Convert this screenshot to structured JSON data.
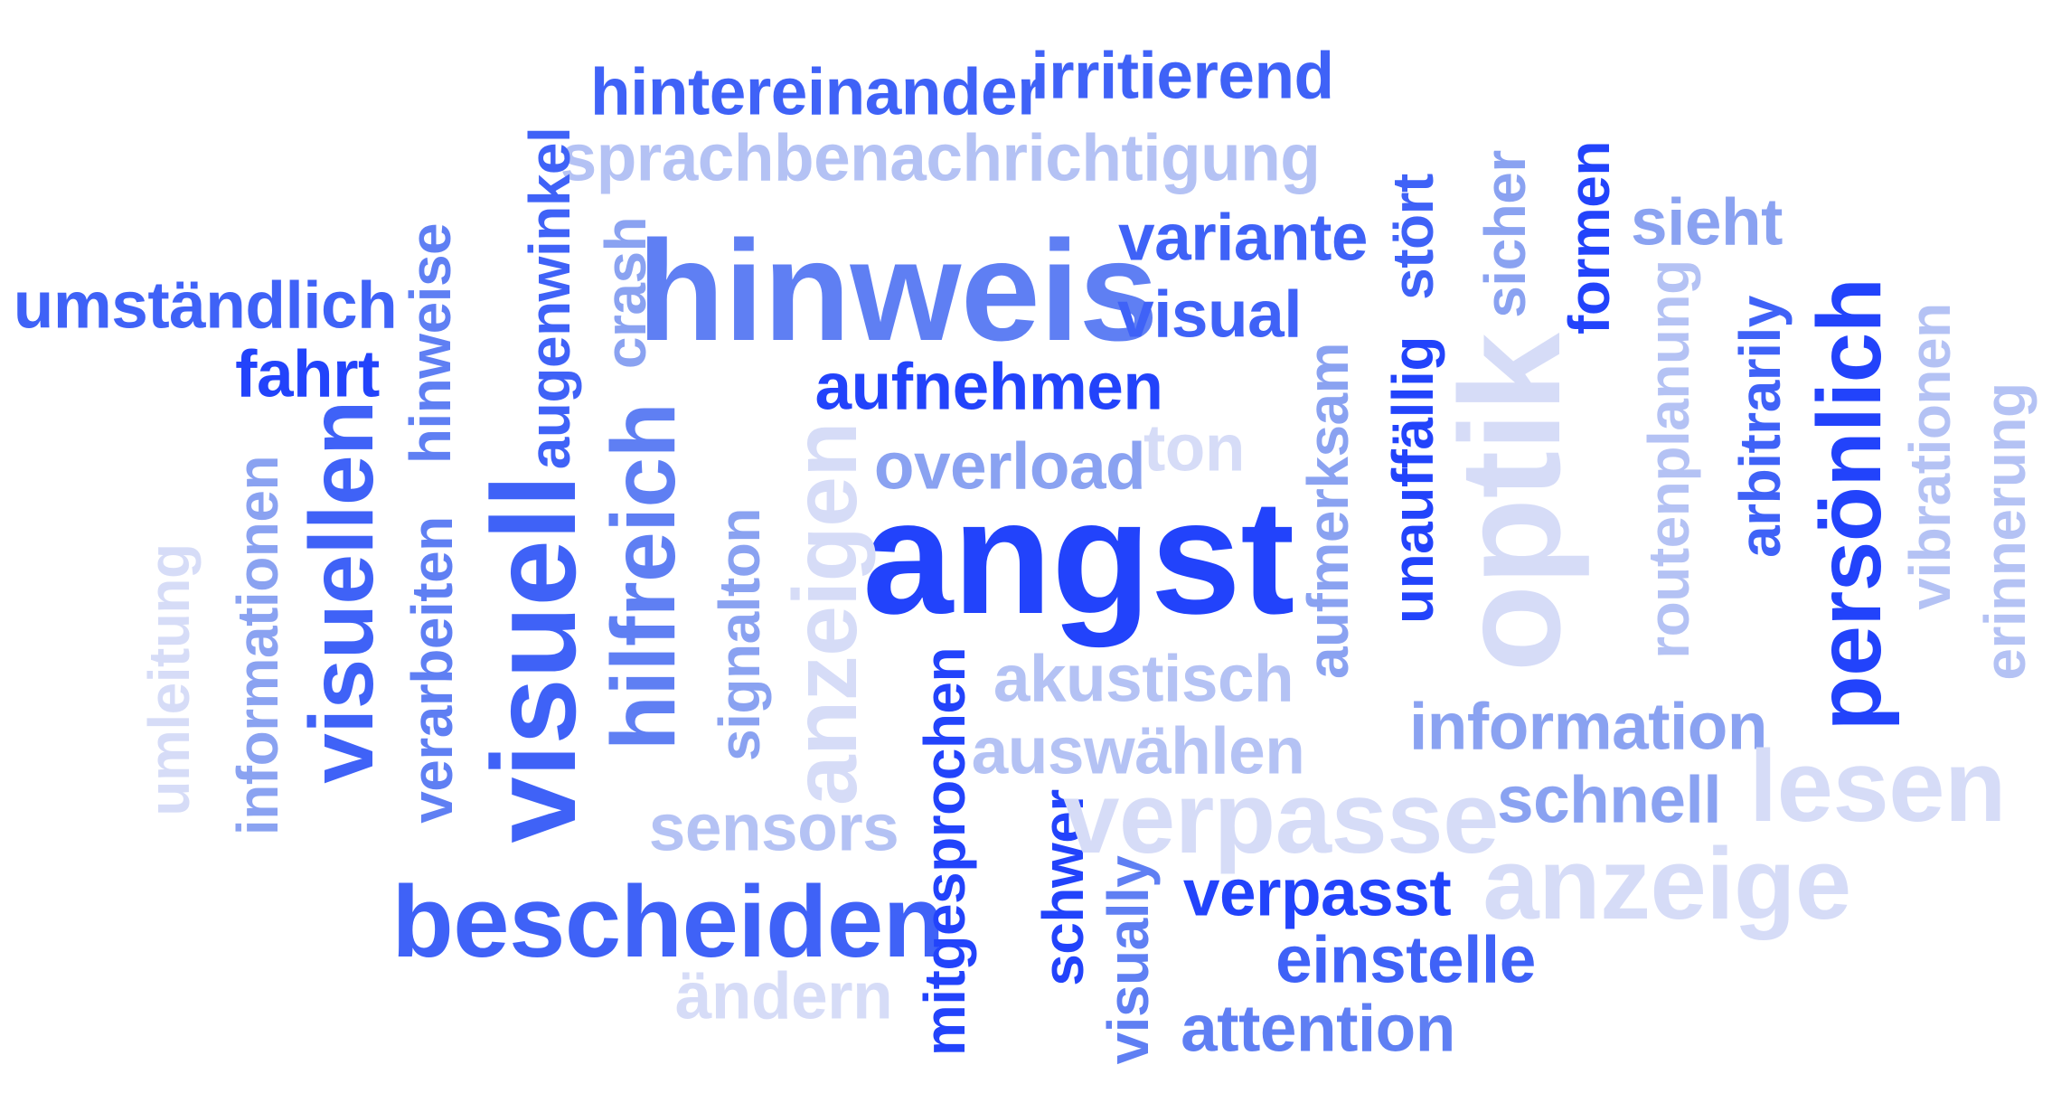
{
  "words": {
    "hintereinander": "hintereinander",
    "irritierend": "irritierend",
    "sprachbenachrichtigung": "sprachbenachrichtigung",
    "hinweis": "hinweis",
    "variante": "variante",
    "visual": "visual",
    "aufnehmen": "aufnehmen",
    "ton": "ton",
    "overload": "overload",
    "angst": "angst",
    "umstaendlich": "umständlich",
    "fahrt": "fahrt",
    "augenwinkel": "augenwinkel",
    "hinweise": "hinweise",
    "crash": "crash",
    "visuellen": "visuellen",
    "visuell": "visuell",
    "hilfreich": "hilfreich",
    "informationen": "informationen",
    "umleitung": "umleitung",
    "verarbeiten": "verarbeiten",
    "signalton": "signalton",
    "anzeigen": "anzeigen",
    "akustisch": "akustisch",
    "auswaehlen": "auswählen",
    "sensors": "sensors",
    "bescheiden": "bescheiden",
    "aendern": "ändern",
    "mitgesprochen": "mitgesprochen",
    "schwer": "schwer",
    "visually": "visually",
    "verpasse": "verpasse",
    "verpasst": "verpasst",
    "einstelle": "einstelle",
    "attention": "attention",
    "aufmerksam": "aufmerksam",
    "stoert": "stört",
    "unauffaellig": "unauffällig",
    "sicher": "sicher",
    "optik": "optik",
    "formen": "formen",
    "sieht": "sieht",
    "routenplanung": "routenplanung",
    "arbitrarily": "arbitrarily",
    "persoenlich": "persönlich",
    "vibrationen": "vibrationen",
    "erinnerung": "erinnerung",
    "information": "information",
    "schnell": "schnell",
    "lesen": "lesen",
    "anzeige": "anzeige"
  },
  "palette": {
    "darkest": "#2243fb",
    "dark": "#3f62f7",
    "medium": "#5f7ff3",
    "light": "#8aa2f1",
    "lighter": "#b4c2f4",
    "lightest": "#d6dcf7"
  }
}
